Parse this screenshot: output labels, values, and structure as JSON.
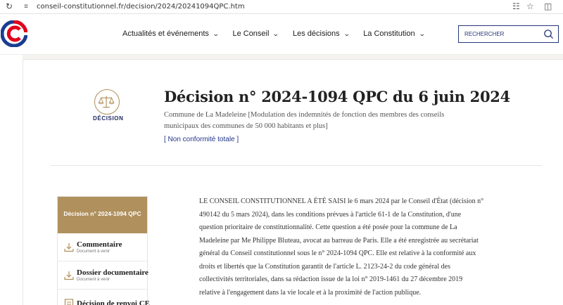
{
  "browser": {
    "url": "conseil-constitutionnel.fr/decision/2024/20241094QPC.htm"
  },
  "header": {
    "nav": [
      {
        "label": "Actualités et événements"
      },
      {
        "label": "Le Conseil"
      },
      {
        "label": "Les décisions"
      },
      {
        "label": "La Constitution"
      }
    ],
    "search_placeholder": "RECHERCHER"
  },
  "decision": {
    "badge_label": "DÉCISION",
    "title": "Décision n° 2024-1094 QPC du 6 juin 2024",
    "subtitle": "Commune de La Madeleine [Modulation des indemnités de fonction des membres des conseils municipaux des communes de 50 000 habitants et plus]",
    "result": "[ Non conformité totale ]"
  },
  "sidebar": {
    "heading": "Décision n° 2024-1094 QPC",
    "items": [
      {
        "label": "Commentaire",
        "sub": "Document à venir"
      },
      {
        "label": "Dossier documentaire",
        "sub": "Document à venir"
      },
      {
        "label": "Décision de renvoi CE",
        "sub": ""
      }
    ]
  },
  "body": {
    "paragraph": "LE CONSEIL CONSTITUTIONNEL A ÉTÉ SAISI le 6 mars 2024 par le Conseil d'État (décision n° 490142 du 5 mars 2024), dans les conditions prévues à l'article 61-1 de la Constitution, d'une question prioritaire de constitutionnalité. Cette question a été posée pour la commune de La Madeleine par Me Philippe Bluteau, avocat au barreau de Paris. Elle a été enregistrée au secrétariat général du Conseil constitutionnel sous le n° 2024-1094 QPC. Elle est relative à la conformité aux droits et libertés que la Constitution garantit de l'article L. 2123-24-2 du code général des collectivités territoriales, dans sa rédaction issue de la loi n° 2019-1461 du 27 décembre 2019 relative à l'engagement dans la vie locale et à la proximité de l'action publique."
  },
  "colors": {
    "gold": "#b0905d",
    "navy": "#26367a",
    "logo_red": "#e2001a",
    "logo_blue": "#1a3d91"
  }
}
